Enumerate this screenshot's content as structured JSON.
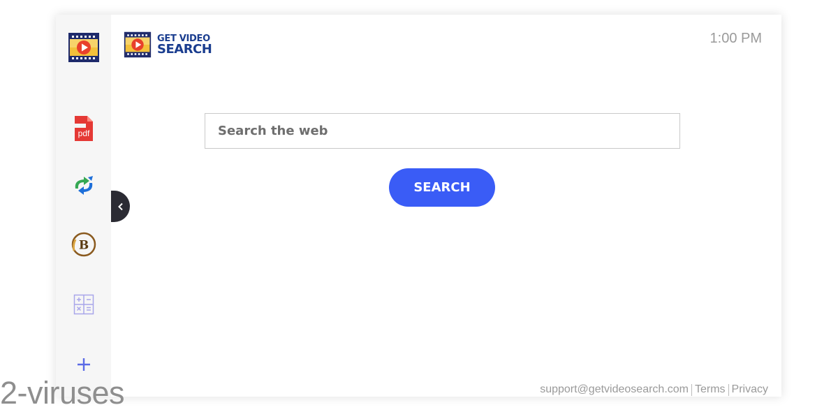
{
  "brand": {
    "line1": "GET VIDEO",
    "line2": "SEARCH",
    "icon": "film-play-icon"
  },
  "clock": "1:00 PM",
  "sidebar": {
    "items": [
      {
        "icon": "film-play-icon"
      },
      {
        "icon": "pdf-icon",
        "label": "pdf"
      },
      {
        "icon": "convert-arrows-icon"
      },
      {
        "icon": "bitcoin-icon",
        "label": "B"
      },
      {
        "icon": "calculator-icon"
      },
      {
        "icon": "plus-icon"
      }
    ],
    "collapse_icon": "chevron-left-icon"
  },
  "search": {
    "placeholder": "Search the web",
    "button_label": "SEARCH"
  },
  "footer": {
    "support": "support@getvideosearch.com",
    "terms": "Terms",
    "privacy": "Privacy"
  },
  "watermark": "2-viruses",
  "colors": {
    "accent": "#3a5cf6",
    "sidebar_bg": "#f6f6f6",
    "brand_text": "#1a3d8f",
    "collapse_tab": "#2b2b33"
  }
}
